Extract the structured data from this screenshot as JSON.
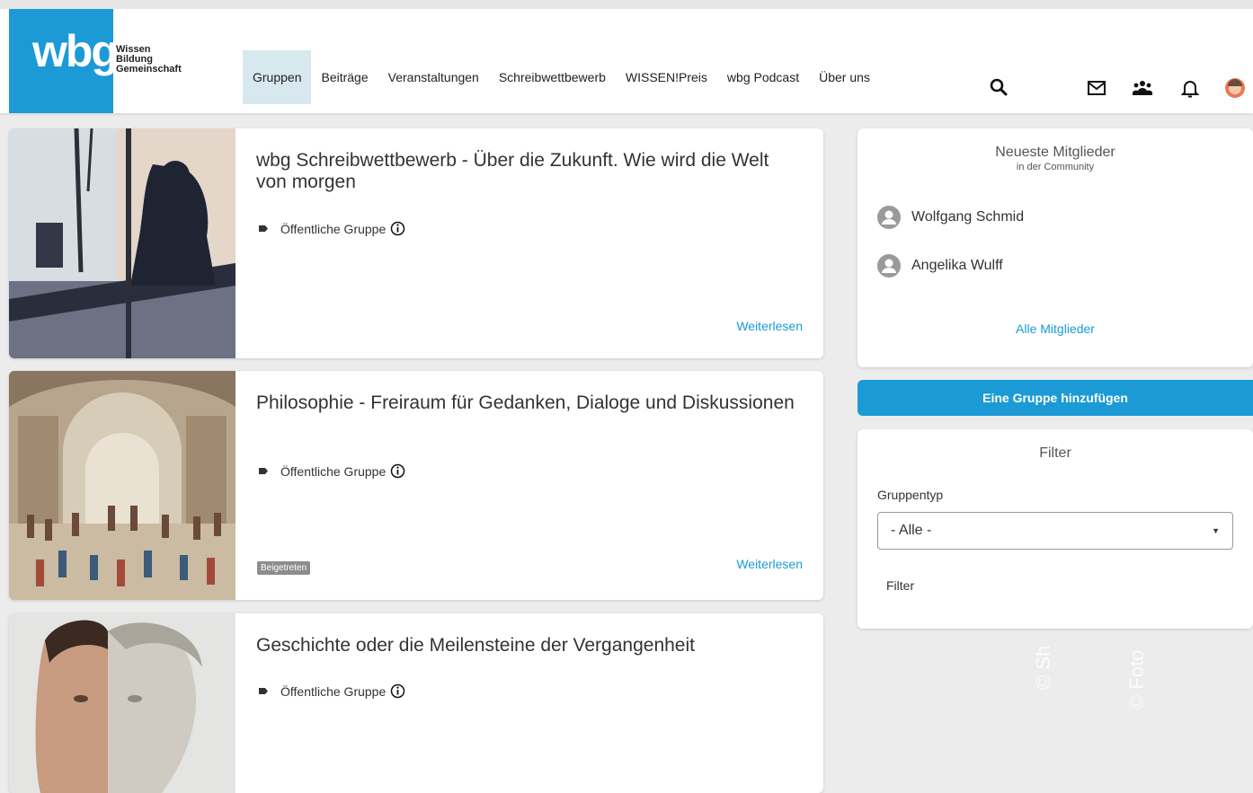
{
  "logo": {
    "mark": "wbg",
    "words": [
      "Wissen",
      "Bildung",
      "Gemeinschaft"
    ]
  },
  "nav": [
    {
      "label": "Gruppen",
      "active": true
    },
    {
      "label": "Beiträge"
    },
    {
      "label": "Veranstaltungen"
    },
    {
      "label": "Schreibwettbewerb"
    },
    {
      "label": "WISSEN!Preis"
    },
    {
      "label": "wbg Podcast"
    },
    {
      "label": "Über uns"
    }
  ],
  "header_icons": [
    "search-icon",
    "mail-icon",
    "group-icon",
    "bell-icon",
    "user-avatar-icon"
  ],
  "groups": [
    {
      "title": "wbg Schreibwettbewerb - Über die Zukunft. Wie wird die Welt von morgen",
      "type": "Öffentliche Gruppe",
      "badge": "",
      "readmore": "Weiterlesen"
    },
    {
      "title": "Philosophie - Freiraum für Gedanken, Dialoge und Diskussionen",
      "type": "Öffentliche Gruppe",
      "badge": "Beigetreten",
      "readmore": "Weiterlesen"
    },
    {
      "title": "Geschichte oder die Meilensteine der Vergangenheit",
      "type": "Öffentliche Gruppe",
      "badge": "",
      "readmore": ""
    }
  ],
  "sidebar": {
    "members_title": "Neueste Mitglieder",
    "members_subtitle": "in der Community",
    "members": [
      "Wolfgang Schmid",
      "Angelika Wulff"
    ],
    "all_members": "Alle Mitglieder",
    "add_group": "Eine Gruppe hinzufügen",
    "filter_title": "Filter",
    "group_type_label": "Gruppentyp",
    "group_type_value": "- Alle -",
    "filter_button": "Filter"
  },
  "watermarks": [
    "© Sh",
    "© Foto"
  ],
  "colors": {
    "accent": "#1b9ad6",
    "active_nav": "#d7e8ee",
    "badge": "#8d8d8d"
  }
}
